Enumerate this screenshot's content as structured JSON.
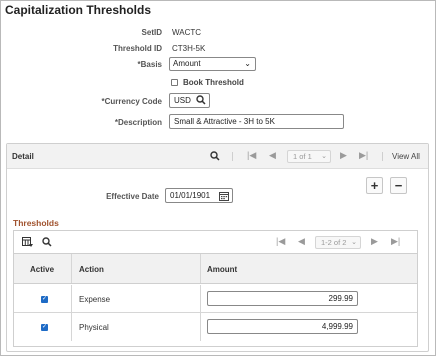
{
  "page": {
    "title": "Capitalization Thresholds"
  },
  "form": {
    "setid": {
      "label": "SetID",
      "value": "WACTC"
    },
    "threshold_id": {
      "label": "Threshold ID",
      "value": "CT3H-5K"
    },
    "basis": {
      "label": "*Basis",
      "value": "Amount"
    },
    "book_threshold": {
      "label": "Book Threshold",
      "checked": false
    },
    "currency_code": {
      "label": "*Currency Code",
      "value": "USD"
    },
    "description": {
      "label": "*Description",
      "value": "Small & Attractive - 3H to 5K"
    }
  },
  "detail": {
    "title": "Detail",
    "pager": "1 of 1",
    "view_all": "View All",
    "effective_date": {
      "label": "Effective Date",
      "value": "01/01/1901"
    },
    "add_label": "+",
    "remove_label": "−"
  },
  "thresholds": {
    "title": "Thresholds",
    "pager": "1-2 of 2",
    "columns": {
      "active": "Active",
      "action": "Action",
      "amount": "Amount"
    },
    "rows": [
      {
        "active": true,
        "action": "Expense",
        "amount": "299.99"
      },
      {
        "active": true,
        "action": "Physical",
        "amount": "4,999.99"
      }
    ]
  },
  "icons": {
    "search": "search-icon",
    "calendar": "calendar-icon",
    "first": "first-page-icon",
    "prev": "previous-icon",
    "next": "next-icon",
    "last": "last-page-icon",
    "chevron": "chevron-down-icon",
    "personalize": "grid-personalize-icon"
  }
}
